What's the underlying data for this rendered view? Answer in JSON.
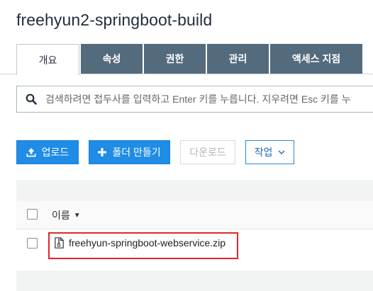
{
  "page": {
    "title": "freehyun2-springboot-build"
  },
  "tabs": [
    {
      "label": "개요",
      "active": true
    },
    {
      "label": "속성",
      "active": false
    },
    {
      "label": "권한",
      "active": false
    },
    {
      "label": "관리",
      "active": false
    },
    {
      "label": "액세스 지점",
      "active": false
    }
  ],
  "search": {
    "icon": "search-icon",
    "placeholder": "검색하려면 접두사를 입력하고 Enter 키를 누릅니다. 지우려면 Esc 키를 누",
    "value": ""
  },
  "toolbar": {
    "upload_label": "업로드",
    "upload_icon": "upload-icon",
    "create_folder_label": "폴더 만들기",
    "create_folder_icon": "plus-icon",
    "download_label": "다운로드",
    "actions_label": "작업",
    "actions_icon": "chevron-down-icon"
  },
  "table": {
    "name_header": "이름",
    "sort_icon": "caret-down-icon",
    "rows": [
      {
        "name": "freehyun-springboot-webservice.zip",
        "icon": "zip-file-icon",
        "highlighted": true
      }
    ]
  },
  "colors": {
    "primary": "#1f8ce6",
    "tab_bg": "#546b7d",
    "highlight_border": "#e0262b",
    "title": "#232f3e"
  }
}
